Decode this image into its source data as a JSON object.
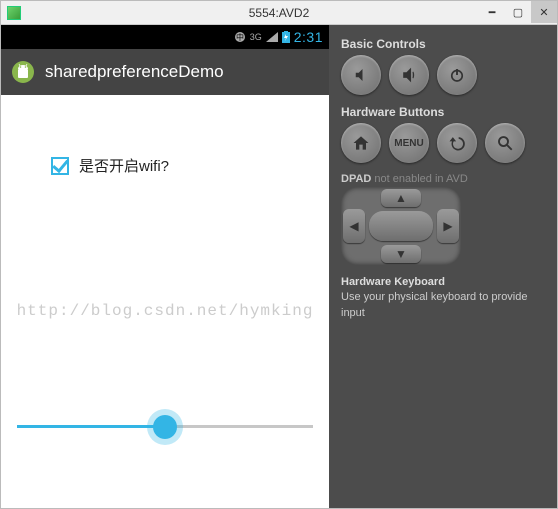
{
  "window": {
    "title": "5554:AVD2"
  },
  "statusbar": {
    "time": "2:31",
    "net_label": "3G"
  },
  "appbar": {
    "title": "sharedpreferenceDemo"
  },
  "content": {
    "checkbox_label": "是否开启wifi?",
    "slider_percent": 50
  },
  "watermark": "http://blog.csdn.net/hymking",
  "panel": {
    "basic_title": "Basic Controls",
    "hardware_title": "Hardware Buttons",
    "menu_label": "MENU",
    "dpad_label": "DPAD",
    "dpad_note": "not enabled in AVD",
    "keyboard_title": "Hardware Keyboard",
    "keyboard_note": "Use your physical keyboard to provide input"
  }
}
